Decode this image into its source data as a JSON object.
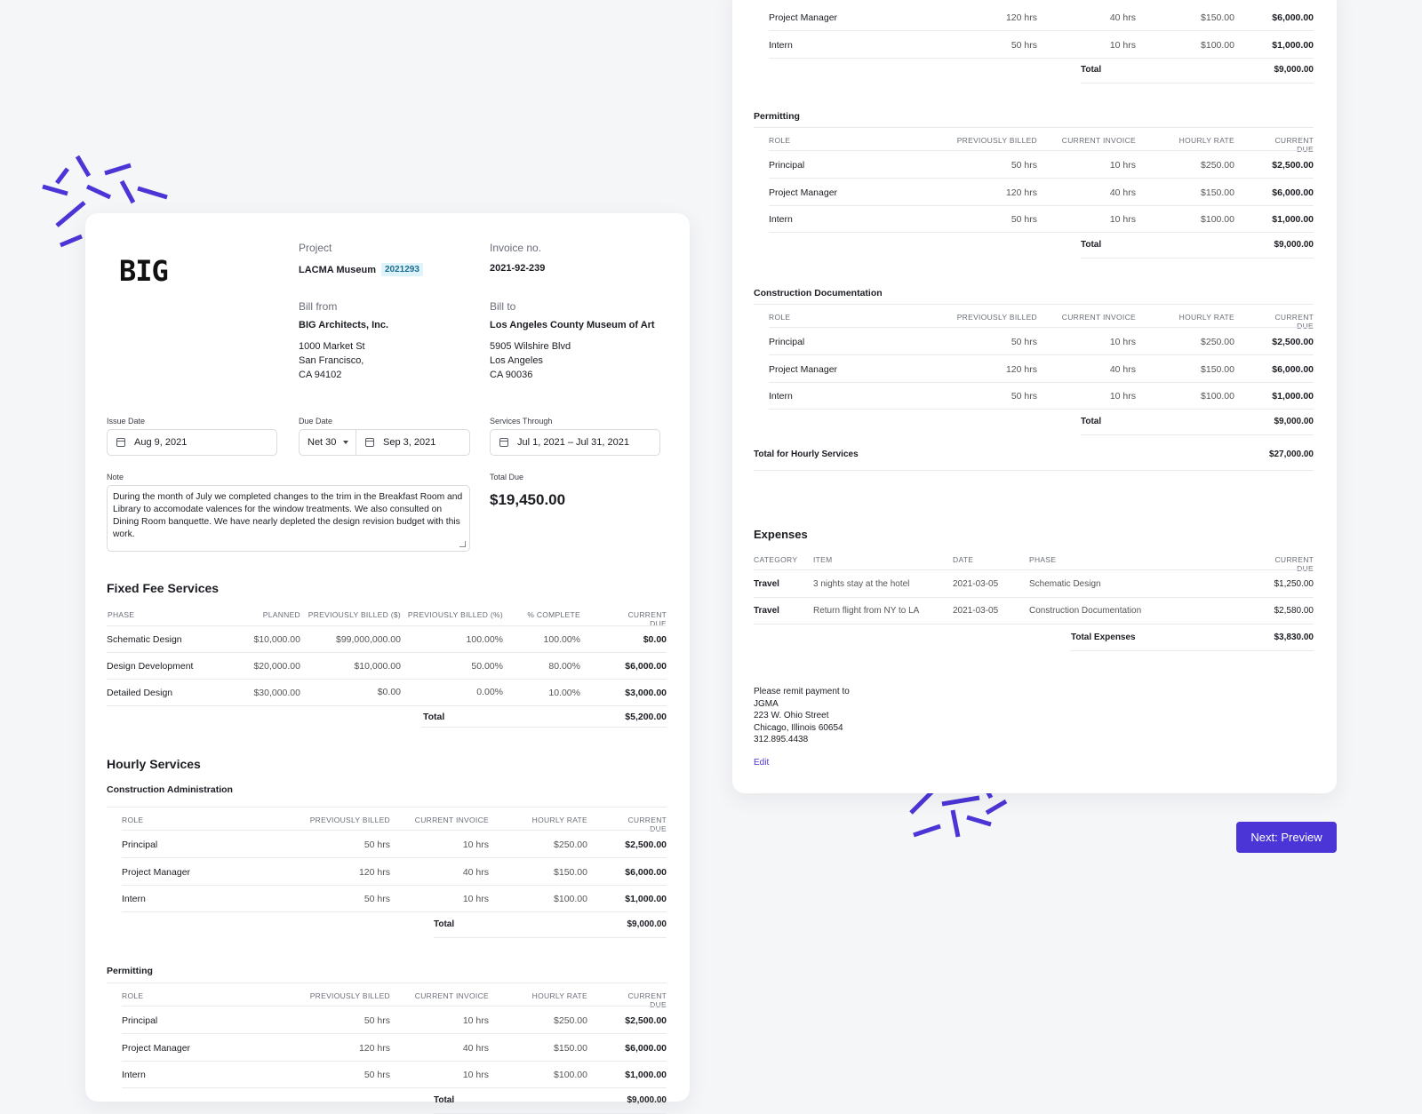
{
  "brand": {
    "logo_text": "BIG",
    "accent": "#4b35d6"
  },
  "invoice": {
    "project_label": "Project",
    "project_name": "LACMA Museum",
    "project_code": "2021293",
    "invoice_no_label": "Invoice no.",
    "invoice_no": "2021-92-239",
    "bill_from_label": "Bill from",
    "bill_from_name": "BIG Architects, Inc.",
    "bill_from_lines": [
      "1000 Market St",
      "San Francisco,",
      "CA 94102"
    ],
    "bill_to_label": "Bill to",
    "bill_to_name": "Los Angeles County Museum of Art",
    "bill_to_lines": [
      "5905 Wilshire Blvd",
      "Los Angeles",
      "CA 90036"
    ]
  },
  "dates": {
    "issue_label": "Issue Date",
    "issue_value": "Aug 9, 2021",
    "due_label": "Due Date",
    "terms_value": "Net 30",
    "due_value": "Sep 3, 2021",
    "services_label": "Services Through",
    "services_value": "Jul 1, 2021 – Jul 31, 2021"
  },
  "note": {
    "label": "Note",
    "text": "During the month of July we completed changes to the trim in the Breakfast Room and Library to accomodate valences for the window treatments. We also consulted on Dining Room banquette. We have nearly depleted the design revision budget with this work."
  },
  "total_due": {
    "label": "Total Due",
    "value": "$19,450.00"
  },
  "fixed_fee": {
    "title": "Fixed Fee Services",
    "columns": [
      "PHASE",
      "PLANNED",
      "PREVIOUSLY BILLED ($)",
      "PREVIOUSLY BILLED (%)",
      "% COMPLETE",
      "CURRENT DUE"
    ],
    "rows": [
      [
        "Schematic Design",
        "$10,000.00",
        "$99,000,000.00",
        "100.00%",
        "100.00%",
        "$0.00"
      ],
      [
        "Design Development",
        "$20,000.00",
        "$10,000.00",
        "50.00%",
        "80.00%",
        "$6,000.00"
      ],
      [
        "Detailed Design",
        "$30,000.00",
        "$0.00",
        "0.00%",
        "10.00%",
        "$3,000.00"
      ]
    ],
    "total_label": "Total",
    "total_value": "$5,200.00"
  },
  "hourly": {
    "title": "Hourly Services",
    "columns": [
      "ROLE",
      "PREVIOUSLY BILLED",
      "CURRENT INVOICE",
      "HOURLY RATE",
      "CURRENT DUE"
    ],
    "rows": [
      [
        "Principal",
        "50 hrs",
        "10 hrs",
        "$250.00",
        "$2,500.00"
      ],
      [
        "Project Manager",
        "120 hrs",
        "40 hrs",
        "$150.00",
        "$6,000.00"
      ],
      [
        "Intern",
        "50 hrs",
        "10 hrs",
        "$100.00",
        "$1,000.00"
      ]
    ],
    "groups": [
      "Construction Administration",
      "Permitting",
      "Construction Documentation"
    ],
    "total_label": "Total",
    "total_value": "$9,000.00",
    "grand_total_label": "Total for Hourly Services",
    "grand_total_value": "$27,000.00"
  },
  "expenses": {
    "title": "Expenses",
    "columns": [
      "CATEGORY",
      "ITEM",
      "DATE",
      "PHASE",
      "CURRENT DUE"
    ],
    "rows": [
      [
        "Travel",
        "3 nights stay at the hotel",
        "2021-03-05",
        "Schematic Design",
        "$1,250.00"
      ],
      [
        "Travel",
        "Return flight from NY to LA",
        "2021-03-05",
        "Construction Documentation",
        "$2,580.00"
      ]
    ],
    "total_label": "Total Expenses",
    "total_value": "$3,830.00"
  },
  "remit": {
    "lines": [
      "Please remit payment to",
      "JGMA",
      "223 W. Ohio Street",
      "Chicago, Illinois 60654",
      "312.895.4438"
    ],
    "edit_label": "Edit"
  },
  "actions": {
    "next_label": "Next: Preview"
  }
}
